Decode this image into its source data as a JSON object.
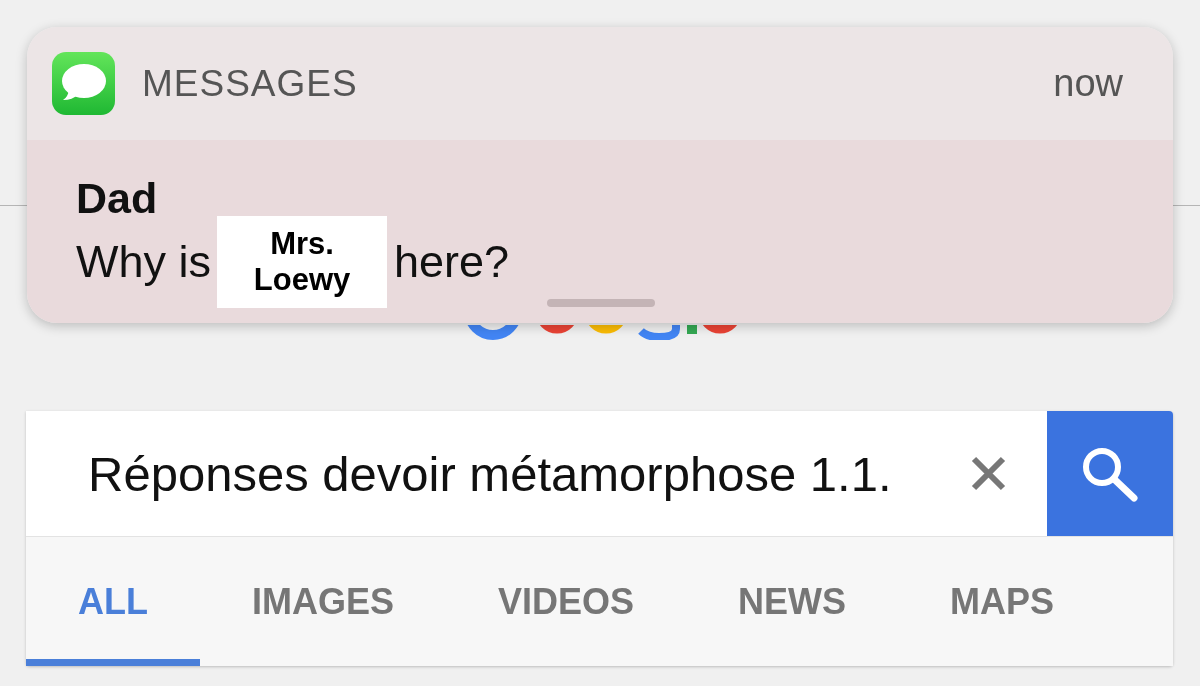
{
  "notification": {
    "app_name": "MESSAGES",
    "time": "now",
    "sender": "Dad",
    "message": {
      "before": "Why is",
      "covered_name": "Mrs. Loewy",
      "after": "here?"
    }
  },
  "search": {
    "value": "Réponses devoir métamorphose 1.1."
  },
  "tabs": [
    {
      "label": "ALL",
      "selected": true
    },
    {
      "label": "IMAGES",
      "selected": false
    },
    {
      "label": "VIDEOS",
      "selected": false
    },
    {
      "label": "NEWS",
      "selected": false
    },
    {
      "label": "MAPS",
      "selected": false
    }
  ]
}
